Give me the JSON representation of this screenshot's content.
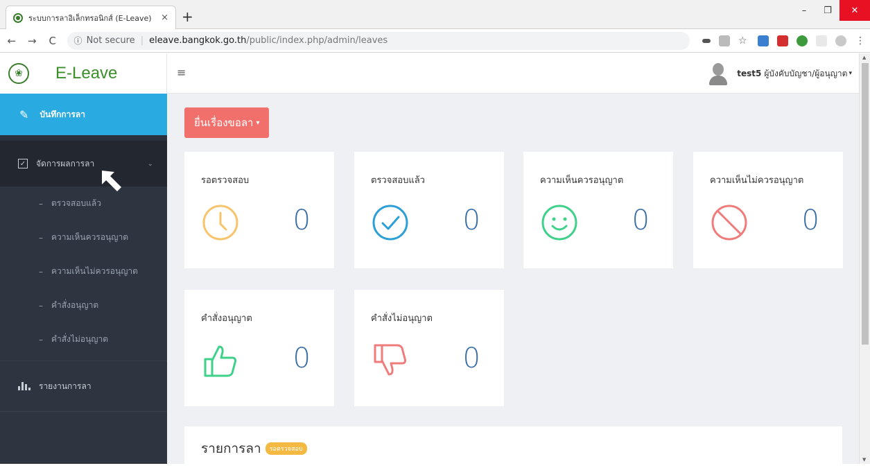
{
  "browser": {
    "tab_title": "ระบบการลาอิเล็กทรอนิกส์ (E-Leave)",
    "tab_close": "×",
    "new_tab": "+",
    "nav_back": "←",
    "nav_forward": "→",
    "nav_reload": "C",
    "url_secure": "Not secure",
    "url_host": "eleave.bangkok.go.th",
    "url_path": "/public/index.php/admin/leaves",
    "win_minimize": "–",
    "win_restore": "❐",
    "win_close": "✕"
  },
  "brand": {
    "name": "E-Leave"
  },
  "sidebar": {
    "primary": {
      "label": "บันทึกการลา",
      "icon": "pencil-icon"
    },
    "group": {
      "label": "จัดการผลการลา",
      "icon": "checkbox-icon",
      "items": [
        {
          "label": "ตรวจสอบแล้ว"
        },
        {
          "label": "ความเห็นควรอนุญาต"
        },
        {
          "label": "ความเห็นไม่ควรอนุญาต"
        },
        {
          "label": "คำสั่งอนุญาต"
        },
        {
          "label": "คำสั่งไม่อนุญาต"
        }
      ]
    },
    "report": {
      "label": "รายงานการลา",
      "icon": "bar-chart-icon"
    },
    "sub_dash": "–"
  },
  "topbar": {
    "menu_icon": "≡",
    "user_name": "test5",
    "user_role": "ผู้บังคับบัญชา/ผู้อนุญาต",
    "user_caret": "▾"
  },
  "content": {
    "apply_button": "ยื่นเรื่องขอลา",
    "apply_caret": "▾",
    "cards": [
      {
        "title": "รอตรวจสอบ",
        "count": "0",
        "icon": "clock-icon",
        "color": "#f7c36b"
      },
      {
        "title": "ตรวจสอบแล้ว",
        "count": "0",
        "icon": "check-circle-icon",
        "color": "#2b9fd6"
      },
      {
        "title": "ความเห็นควรอนุญาต",
        "count": "0",
        "icon": "smile-icon",
        "color": "#3ed18a"
      },
      {
        "title": "ความเห็นไม่ควรอนุญาต",
        "count": "0",
        "icon": "prohibited-icon",
        "color": "#f07b7b"
      },
      {
        "title": "คำสั่งอนุญาต",
        "count": "0",
        "icon": "thumbs-up-icon",
        "color": "#3ed18a"
      },
      {
        "title": "คำสั่งไม่อนุญาต",
        "count": "0",
        "icon": "thumbs-down-icon",
        "color": "#f07b7b"
      }
    ],
    "list_title": "รายการลา",
    "list_badge": "รอตรวจสอบ"
  }
}
